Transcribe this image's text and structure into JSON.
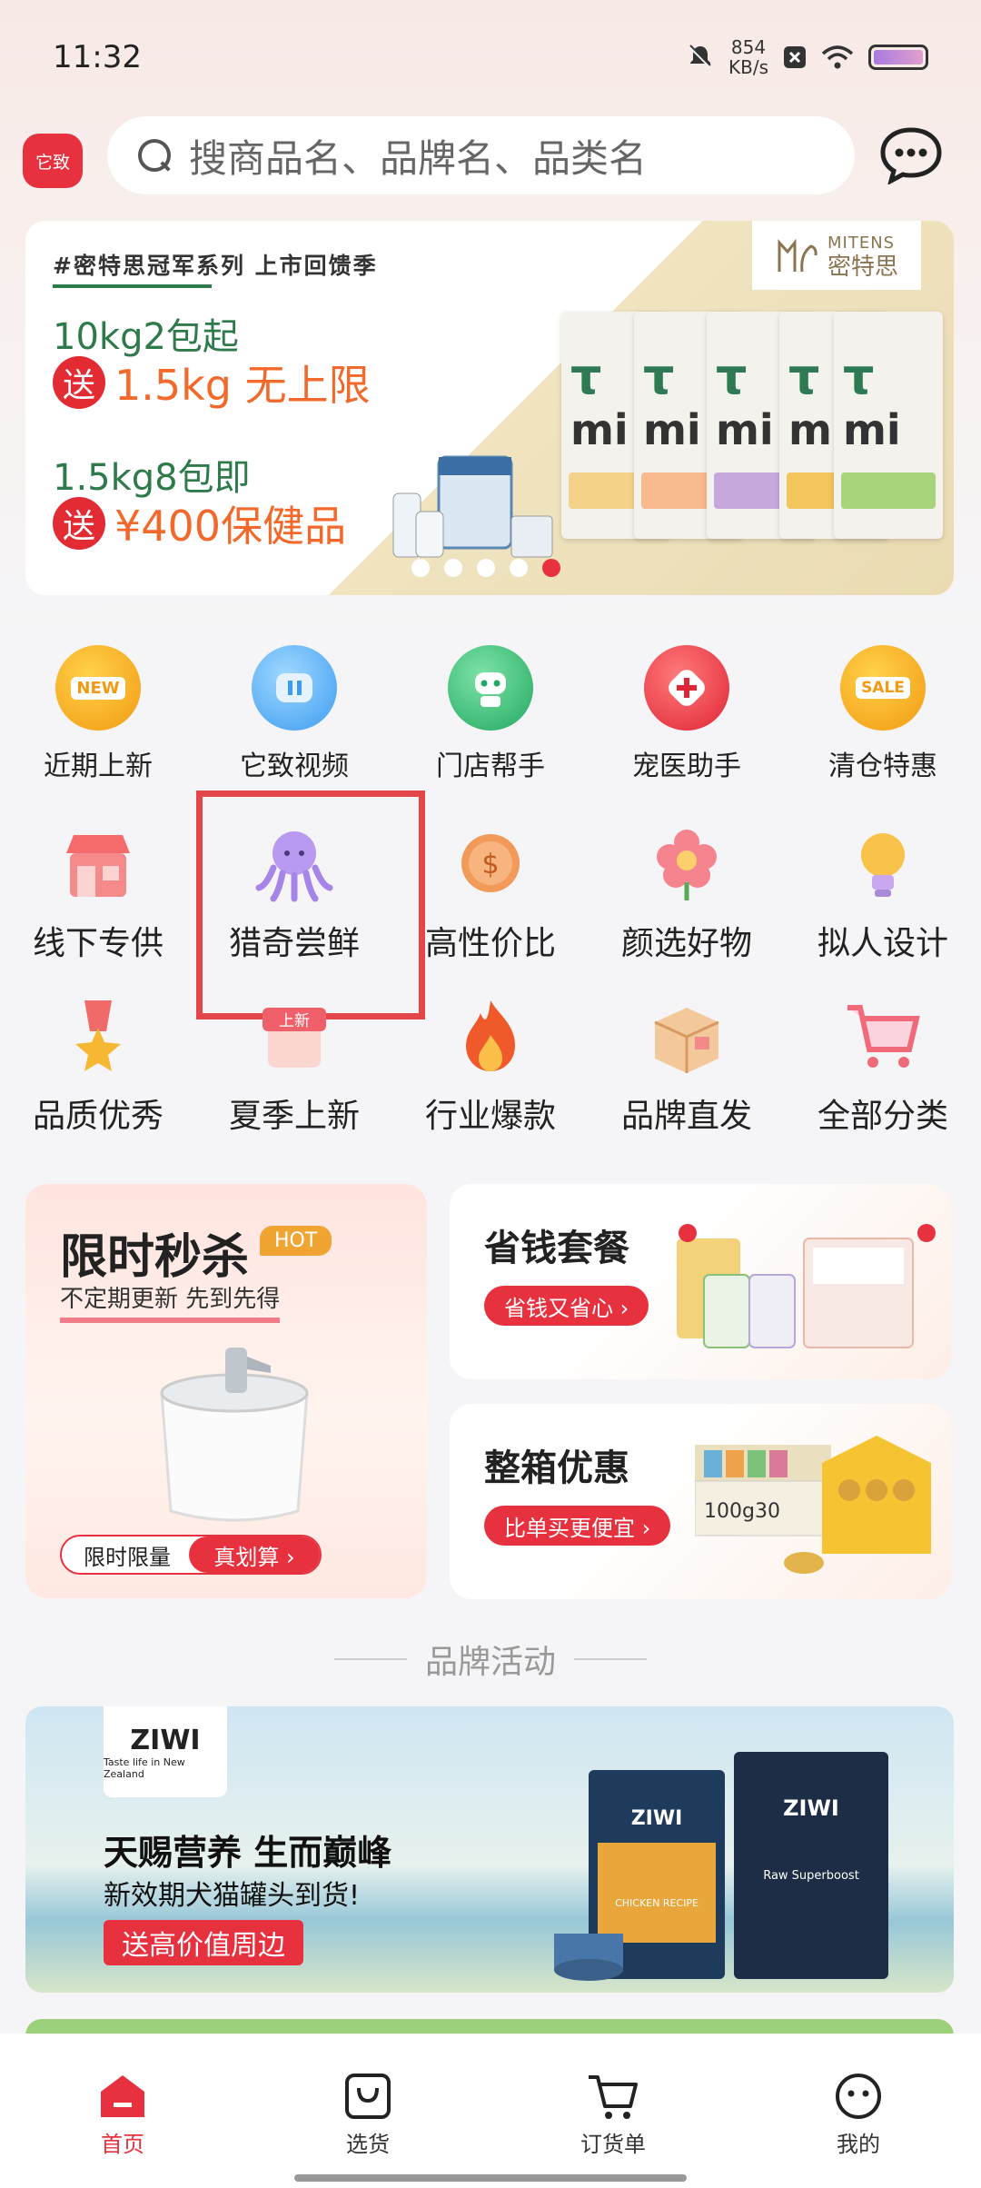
{
  "status_bar": {
    "time": "11:32",
    "speed_value": "854",
    "speed_unit": "KB/s"
  },
  "header": {
    "logo_text": "它致",
    "search_placeholder": "搜商品名、品牌名、品类名"
  },
  "banner": {
    "brand_en": "MITENS",
    "brand_cn": "密特思",
    "tag": "#密特思冠军系列 上市回馈季",
    "line1": "10kg2包起",
    "send": "送",
    "line2": "1.5kg 无上限",
    "line3": "1.5kg8包即",
    "line4": "¥400保健品",
    "bag_text": "mi",
    "active_slide": 5,
    "total_slides": 5
  },
  "quick_nav": [
    {
      "label": "近期上新",
      "icon": "new-badge-icon",
      "color": "#f7a81f",
      "badge": "NEW"
    },
    {
      "label": "它致视频",
      "icon": "video-icon",
      "color": "#5fb6f5"
    },
    {
      "label": "门店帮手",
      "icon": "robot-icon",
      "color": "#35c07a"
    },
    {
      "label": "宠医助手",
      "icon": "medical-cross-icon",
      "color": "#e8313f"
    },
    {
      "label": "清仓特惠",
      "icon": "sale-badge-icon",
      "color": "#f7a81f",
      "badge": "SALE"
    }
  ],
  "categories_row1": [
    {
      "label": "线下专供",
      "icon": "storefront-icon"
    },
    {
      "label": "猎奇尝鲜",
      "icon": "octopus-icon"
    },
    {
      "label": "高性价比",
      "icon": "coin-icon"
    },
    {
      "label": "颜选好物",
      "icon": "flower-icon"
    },
    {
      "label": "拟人设计",
      "icon": "lightbulb-icon"
    }
  ],
  "categories_row2": [
    {
      "label": "品质优秀",
      "icon": "star-medal-icon"
    },
    {
      "label": "夏季上新",
      "icon": "summer-new-icon",
      "badge": "上新"
    },
    {
      "label": "行业爆款",
      "icon": "fire-icon"
    },
    {
      "label": "品牌直发",
      "icon": "package-box-icon"
    },
    {
      "label": "全部分类",
      "icon": "shopping-cart-icon"
    }
  ],
  "flash_sale": {
    "title": "限时秒杀",
    "hot": "HOT",
    "subtitle": "不定期更新 先到先得",
    "limit_left": "限时限量",
    "limit_right": "真划算 ›"
  },
  "save_bundle": {
    "title": "省钱套餐",
    "pill": "省钱又省心 ›"
  },
  "box_deal": {
    "title": "整箱优惠",
    "pill": "比单买更便宜 ›",
    "label": "100g30"
  },
  "brand_section": {
    "title": "品牌活动"
  },
  "brand_banner": {
    "logo": "ZIWI",
    "logo_small": "Taste life in New Zealand",
    "title": "天赐营养 生而巅峰",
    "subtitle": "新效期犬猫罐头到货!",
    "button": "送高价值周边",
    "product1": "CHICKEN RECIPE",
    "product2": "Raw Superboost"
  },
  "tabbar": [
    {
      "label": "首页",
      "icon": "home-icon",
      "active": true
    },
    {
      "label": "选货",
      "icon": "shopping-bag-icon",
      "active": false
    },
    {
      "label": "订货单",
      "icon": "cart-icon",
      "active": false
    },
    {
      "label": "我的",
      "icon": "profile-face-icon",
      "active": false
    }
  ],
  "colors": {
    "accent": "#e8313f",
    "green": "#2f7a4b",
    "orange": "#f2692b"
  }
}
